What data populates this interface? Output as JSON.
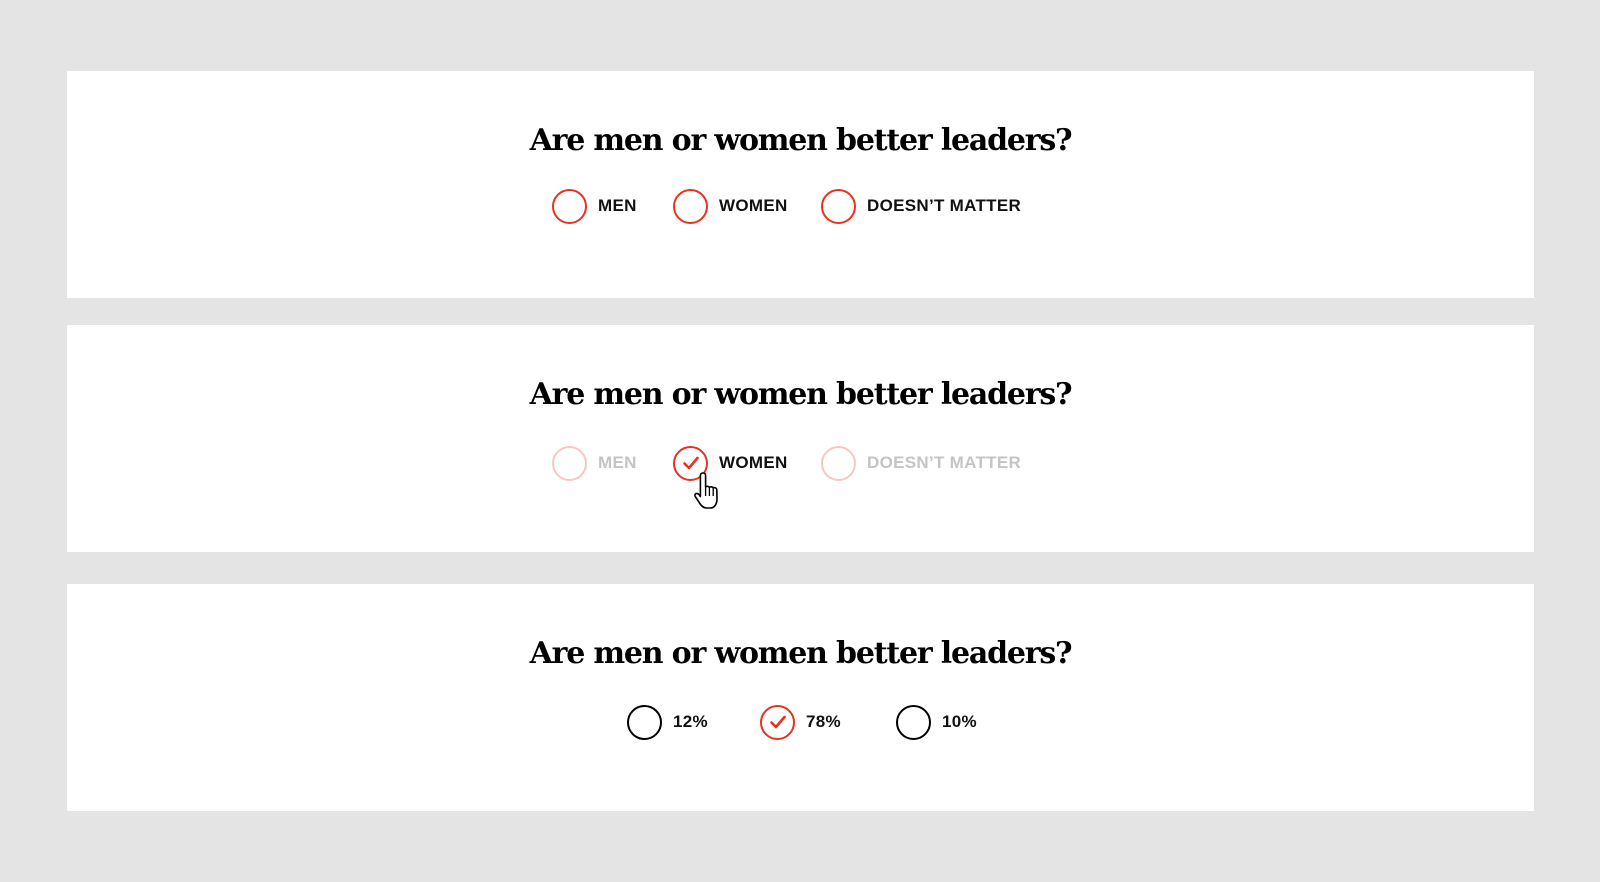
{
  "polls": [
    {
      "question": "Are men or women better leaders?",
      "options": [
        {
          "label": "MEN",
          "state": "unselected"
        },
        {
          "label": "WOMEN",
          "state": "unselected"
        },
        {
          "label": "DOESN’T MATTER",
          "state": "unselected"
        }
      ]
    },
    {
      "question": "Are men or women better leaders?",
      "options": [
        {
          "label": "MEN",
          "state": "faded"
        },
        {
          "label": "WOMEN",
          "state": "selected"
        },
        {
          "label": "DOESN’T MATTER",
          "state": "faded"
        }
      ],
      "cursor": "hand-pointer-icon"
    },
    {
      "question": "Are men or women better leaders?",
      "options": [
        {
          "label": "12%",
          "state": "result"
        },
        {
          "label": "78%",
          "state": "selected"
        },
        {
          "label": "10%",
          "state": "result"
        }
      ]
    }
  ],
  "colors": {
    "accent": "#e8321f",
    "faded_ring": "#f6c8c2",
    "faded_text": "#c4c4c4",
    "background": "#e4e4e4",
    "panel": "#ffffff"
  }
}
